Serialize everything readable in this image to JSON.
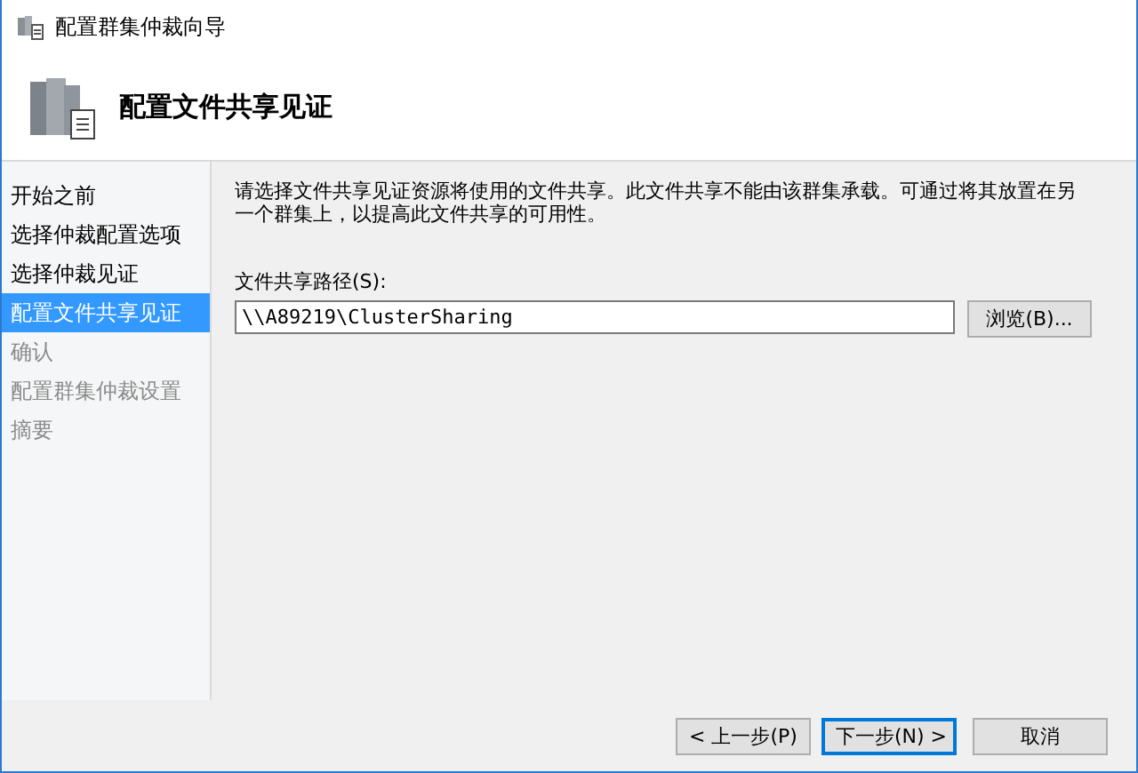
{
  "window": {
    "title": "配置群集仲裁向导"
  },
  "header": {
    "title": "配置文件共享见证"
  },
  "sidebar": {
    "items": [
      {
        "label": "开始之前",
        "selected": false,
        "disabled": false
      },
      {
        "label": "选择仲裁配置选项",
        "selected": false,
        "disabled": false
      },
      {
        "label": "选择仲裁见证",
        "selected": false,
        "disabled": false
      },
      {
        "label": "配置文件共享见证",
        "selected": true,
        "disabled": false
      },
      {
        "label": "确认",
        "selected": false,
        "disabled": true
      },
      {
        "label": "配置群集仲裁设置",
        "selected": false,
        "disabled": true
      },
      {
        "label": "摘要",
        "selected": false,
        "disabled": true
      }
    ]
  },
  "content": {
    "description": "请选择文件共享见证资源将使用的文件共享。此文件共享不能由该群集承载。可通过将其放置在另一个群集上，以提高此文件共享的可用性。",
    "path_label": "文件共享路径(S):",
    "path_value": "\\\\A89219\\ClusterSharing",
    "browse_button": "浏览(B)..."
  },
  "buttons": [
    {
      "label": "< 上一步(P)",
      "default": false
    },
    {
      "label": "下一步(N) >",
      "default": true
    },
    {
      "label": "取消",
      "default": false
    }
  ]
}
